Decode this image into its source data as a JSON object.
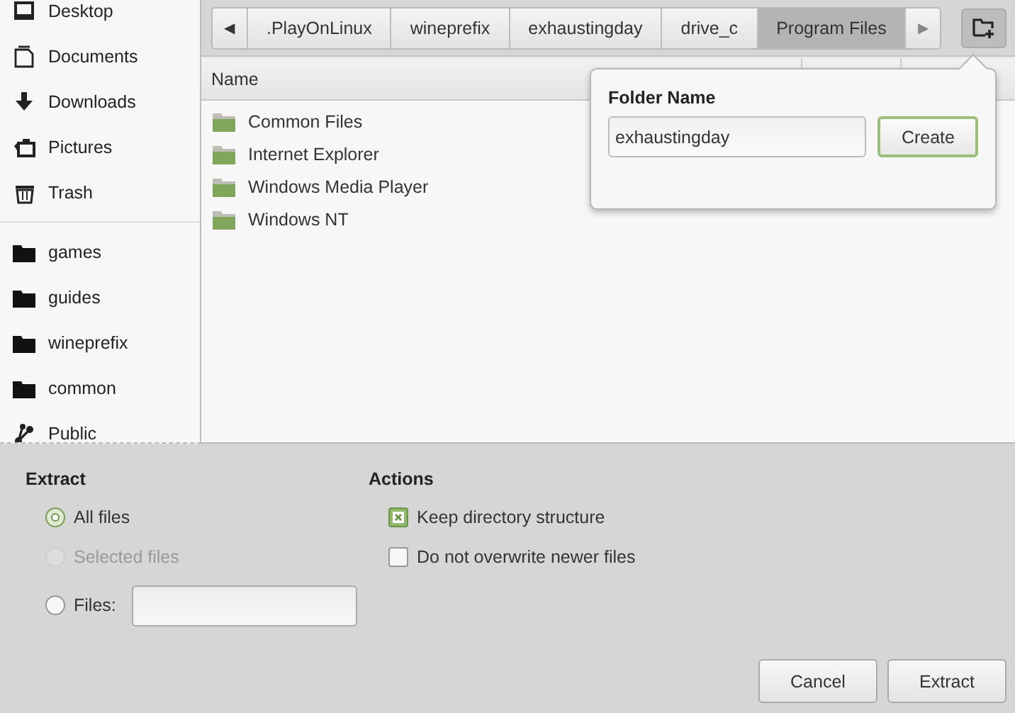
{
  "sidebar": {
    "places": [
      {
        "label": "Desktop",
        "kind": "desktop"
      },
      {
        "label": "Documents",
        "kind": "documents"
      },
      {
        "label": "Downloads",
        "kind": "downloads"
      },
      {
        "label": "Pictures",
        "kind": "pictures"
      },
      {
        "label": "Trash",
        "kind": "trash"
      }
    ],
    "bookmarks": [
      {
        "label": "games",
        "kind": "folder"
      },
      {
        "label": "guides",
        "kind": "folder"
      },
      {
        "label": "wineprefix",
        "kind": "folder"
      },
      {
        "label": "common",
        "kind": "folder"
      },
      {
        "label": "Public",
        "kind": "share"
      }
    ]
  },
  "pathbar": {
    "back": "◀",
    "forward": "▶",
    "segments": [
      {
        "label": ".PlayOnLinux",
        "selected": false
      },
      {
        "label": "wineprefix",
        "selected": false
      },
      {
        "label": "exhaustingday",
        "selected": false
      },
      {
        "label": "drive_c",
        "selected": false
      },
      {
        "label": "Program Files",
        "selected": true
      }
    ]
  },
  "table": {
    "columns": [
      "Name"
    ],
    "rows": [
      {
        "name": "Common Files"
      },
      {
        "name": "Internet Explorer"
      },
      {
        "name": "Windows Media Player"
      },
      {
        "name": "Windows NT"
      }
    ]
  },
  "new_folder_popover": {
    "title": "Folder Name",
    "value": "exhaustingday",
    "button": "Create"
  },
  "extract": {
    "title": "Extract",
    "options": [
      {
        "label": "All files",
        "selected": true,
        "disabled": false,
        "kind": "radio"
      },
      {
        "label": "Selected files",
        "selected": false,
        "disabled": true,
        "kind": "radio"
      },
      {
        "label": "Files:",
        "selected": false,
        "disabled": false,
        "kind": "radio-field"
      }
    ]
  },
  "actions": {
    "title": "Actions",
    "options": [
      {
        "label": "Keep directory structure",
        "checked": true
      },
      {
        "label": "Do not overwrite newer files",
        "checked": false
      }
    ]
  },
  "buttons": [
    "Cancel",
    "Extract"
  ]
}
